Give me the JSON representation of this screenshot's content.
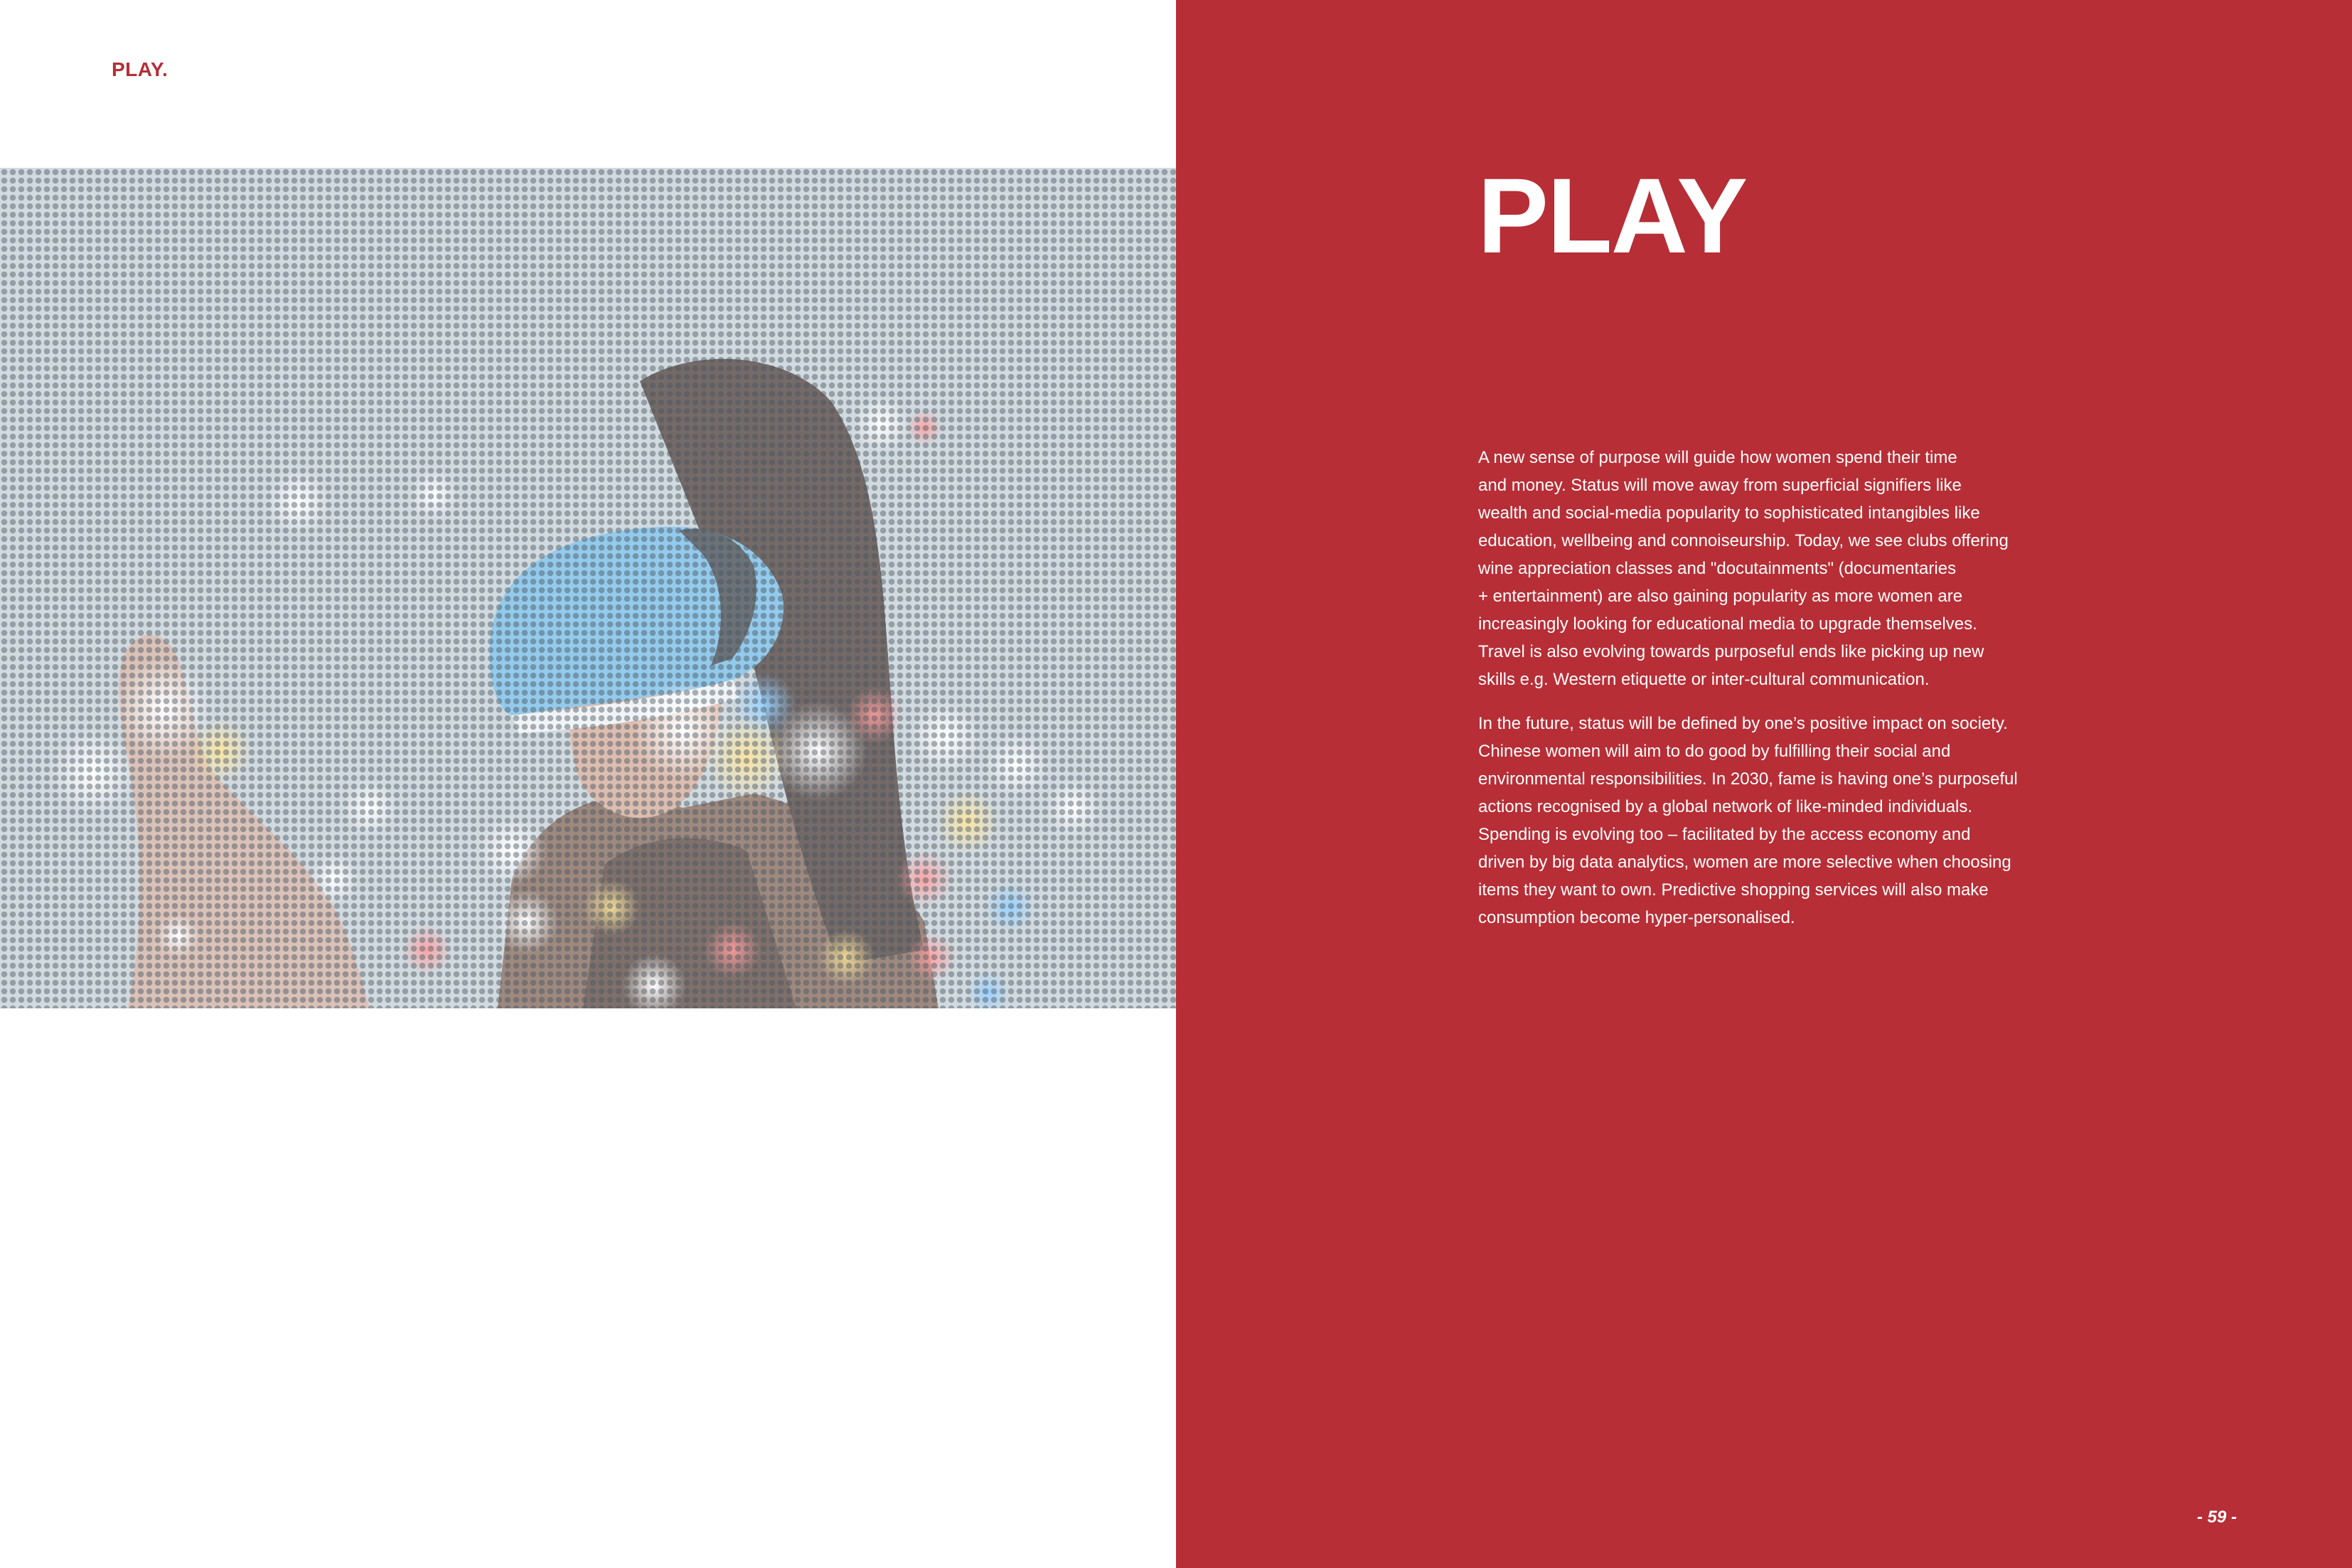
{
  "header": {
    "section_tag": "PLAY."
  },
  "hero_image": {
    "alt": "Woman wearing a virtual reality headset reaching out toward blurred lights, rendered in a halftone dot pattern"
  },
  "panel": {
    "title": "PLAY",
    "paragraph_1_lines": [
      "A new sense of purpose will guide how women spend their time",
      "and money. Status will move away from superficial signifiers like",
      "wealth and social-media popularity to sophisticated intangibles like",
      "education, wellbeing and connoiseurship. Today, we see clubs offering",
      "wine appreciation classes and \"docutainments\" (documentaries",
      "+ entertainment) are also gaining popularity as more women are",
      "increasingly looking for educational media to upgrade themselves.",
      "Travel is also evolving towards purposeful ends like picking up new",
      "skills e.g. Western etiquette or inter-cultural communication."
    ],
    "paragraph_2_lines": [
      "In the future, status will be defined by one’s positive impact on society.",
      "Chinese women will aim to do good by fulfilling their social and",
      "environmental responsibilities. In 2030, fame is having one’s purposeful",
      "actions recognised by a global network of like-minded individuals.",
      "Spending is evolving too – facilitated by the access economy and",
      "driven by big data analytics, women are more selective when choosing",
      "items they want to own. Predictive shopping services will also make",
      "consumption become hyper-personalised."
    ]
  },
  "footer": {
    "page_number": "- 59 -"
  },
  "colors": {
    "accent_red": "#b72e36",
    "tag_red": "#b52e36",
    "text_on_red": "#ffffff"
  }
}
